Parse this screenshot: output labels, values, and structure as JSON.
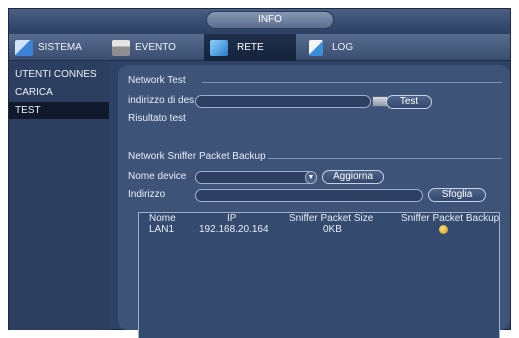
{
  "header": {
    "title": "INFO"
  },
  "nav": {
    "items": [
      {
        "label": "SISTEMA",
        "icon": "system-icon"
      },
      {
        "label": "EVENTO",
        "icon": "event-icon"
      },
      {
        "label": "RETE",
        "icon": "network-icon",
        "active": true
      },
      {
        "label": "LOG",
        "icon": "log-icon"
      }
    ]
  },
  "sidebar": {
    "items": [
      {
        "label": "UTENTI CONNES"
      },
      {
        "label": "CARICA"
      },
      {
        "label": "TEST",
        "active": true
      }
    ]
  },
  "network_test": {
    "section_title": "Network Test",
    "address_label": "indirizzo di des",
    "address_value": "",
    "test_button": "Test",
    "result_label": "Risultato test"
  },
  "sniffer": {
    "section_title": "Network Sniffer Packet Backup",
    "device_label": "Nome device",
    "device_value": "",
    "refresh_button": "Aggiorna",
    "path_label": "Indirizzo",
    "path_value": "",
    "browse_button": "Sfoglia",
    "table": {
      "columns": [
        "Nome",
        "IP",
        "Sniffer Packet Size",
        "Sniffer Packet Backup"
      ],
      "rows": [
        {
          "name": "LAN1",
          "ip": "192.168.20.164",
          "size": "0KB",
          "backup_icon": "backup-icon"
        }
      ]
    }
  },
  "colors": {
    "panel": "#3e5378",
    "frame": "#2e4266",
    "active_tab": "#14233b"
  }
}
